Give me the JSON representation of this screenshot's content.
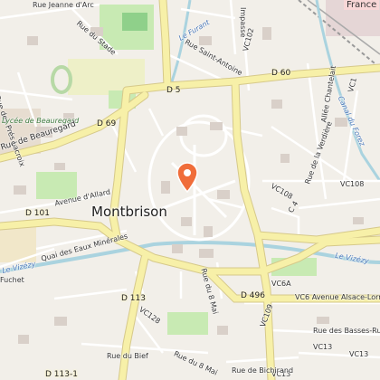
{
  "map": {
    "city_name": "Montbrison",
    "marker_icon": "location-pin-icon",
    "colors": {
      "background": "#f2efe9",
      "major_road": "#f7f0a8",
      "road_outline": "#d6c98a",
      "water": "#aad3df",
      "park": "#c8eab3",
      "marker": "#f06d3a"
    },
    "labels": {
      "rue_jeanne_arc": "Rue Jeanne d'Arc",
      "france": "France",
      "rue_du_stade": "Rue du Stade",
      "le_furant": "Le Furant",
      "impasse": "Impasse",
      "rue_saint_antoine": "Rue Saint-Antoine",
      "vc102": "VC102",
      "allee_chantelait": "Allée Chantelait",
      "vc1": "VC1",
      "canal_du_forez": "Canal du Forez",
      "rue_des_pres_lacroix": "Rue des Prés Lacroix",
      "lycee_beauregard": "Lycée de Beauregard",
      "rue_de_beauregard": "Rue de Beauregard",
      "rue_de_la_verdiere": "Rue de la Verdière",
      "vc108_1": "VC108",
      "vc108_2": "VC108",
      "c4": "C 4",
      "avenue_allard": "Avenue d'Allard",
      "quai_eaux_minerales": "Quai des Eaux Minérales",
      "le_vizezy_left": "Le Vizézy",
      "le_vizezy_right": "Le Vizézy",
      "fuchet": "Fuchet",
      "vc6a": "VC6A",
      "vc6_avenue": "VC6  Avenue Alsace-Lorraine",
      "rue_du_8_mai": "Rue du 8 Mai",
      "vc109": "VC109",
      "rue_basses_rues": "Rue des Basses-Rues",
      "vc13_1": "VC13",
      "vc13_2": "VC13",
      "vc13_3": "VC13",
      "vc128": "VC128",
      "rue_du_bief": "Rue du Bief",
      "rue_de_bichirand": "Rue de Bichirand",
      "rue_du_8_mai_bottom": "Rue du 8 Mai"
    },
    "road_refs": {
      "d5": "D 5",
      "d60": "D 60",
      "d69": "D 69",
      "d101": "D 101",
      "d113": "D 113",
      "d113_1": "D 113-1",
      "d496": "D 496"
    }
  }
}
